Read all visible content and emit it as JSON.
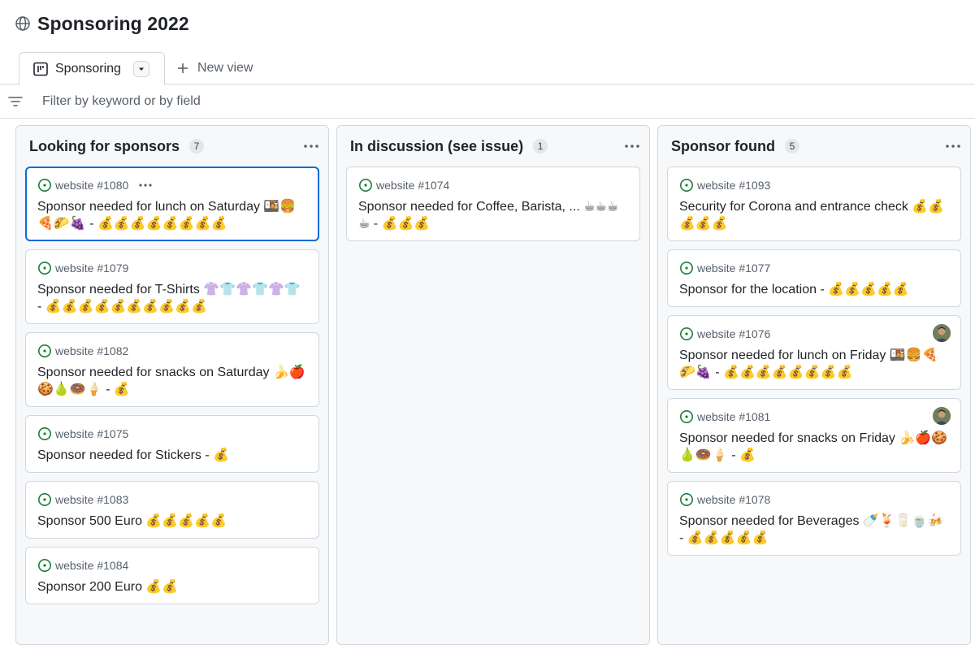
{
  "project": {
    "title": "Sponsoring 2022"
  },
  "tabs": {
    "active_label": "Sponsoring",
    "new_view_label": "New view"
  },
  "filter": {
    "placeholder": "Filter by keyword or by field"
  },
  "columns": [
    {
      "title": "Looking for sponsors",
      "count": "7",
      "cards": [
        {
          "ref": "website #1080",
          "title": "Sponsor needed for lunch on Saturday 🍱🍔🍕🌮🍇 - 💰💰💰💰💰💰💰💰",
          "selected": true
        },
        {
          "ref": "website #1079",
          "title": "Sponsor needed for T-Shirts 👚👕👚👕👚👕 - 💰💰💰💰💰💰💰💰💰💰"
        },
        {
          "ref": "website #1082",
          "title": "Sponsor needed for snacks on Saturday 🍌🍎🍪🍐🍩🍦 - 💰"
        },
        {
          "ref": "website #1075",
          "title": "Sponsor needed for Stickers - 💰"
        },
        {
          "ref": "website #1083",
          "title": "Sponsor 500 Euro 💰💰💰💰💰"
        },
        {
          "ref": "website #1084",
          "title": "Sponsor 200 Euro 💰💰"
        }
      ]
    },
    {
      "title": "In discussion (see issue)",
      "count": "1",
      "cards": [
        {
          "ref": "website #1074",
          "title": "Sponsor needed for Coffee, Barista, ... ☕☕☕☕ - 💰💰💰"
        }
      ]
    },
    {
      "title": "Sponsor found",
      "count": "5",
      "cards": [
        {
          "ref": "website #1093",
          "title": "Security for Corona and entrance check 💰💰💰💰💰"
        },
        {
          "ref": "website #1077",
          "title": "Sponsor for the location - 💰💰💰💰💰"
        },
        {
          "ref": "website #1076",
          "title": "Sponsor needed for lunch on Friday 🍱🍔🍕🌮🍇 - 💰💰💰💰💰💰💰💰",
          "avatar": true
        },
        {
          "ref": "website #1081",
          "title": "Sponsor needed for snacks on Friday 🍌🍎🍪🍐🍩🍦 - 💰",
          "avatar": true
        },
        {
          "ref": "website #1078",
          "title": "Sponsor needed for Beverages 🍼🍹🥛🍵🍻 - 💰💰💰💰💰"
        }
      ]
    }
  ],
  "icons": {
    "globe": "globe-icon",
    "board": "project-board-icon",
    "dropdown": "triangle-down-icon",
    "plus": "plus-icon",
    "filter": "filter-icon",
    "menu": "kebab-horizontal-icon",
    "issue": "issue-opened-icon"
  },
  "colors": {
    "accent": "#0969da",
    "issue_open": "#1a7f37",
    "border": "#d0d7de",
    "column_bg": "#f6f8fa"
  }
}
